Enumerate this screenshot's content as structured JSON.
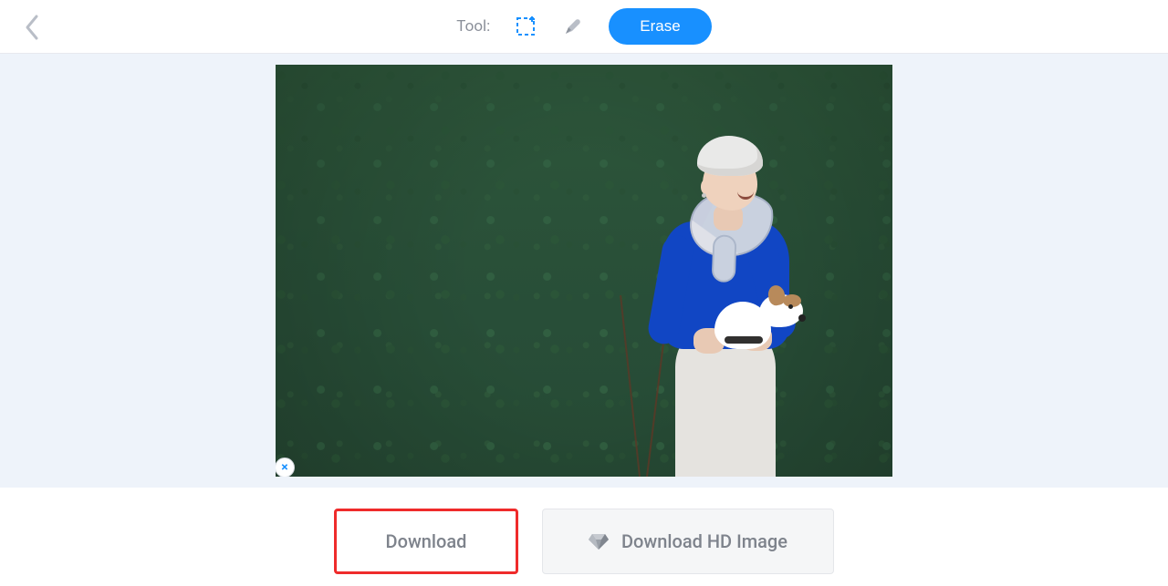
{
  "toolbar": {
    "tool_label": "Tool:",
    "erase_label": "Erase"
  },
  "image": {
    "close_label": "×"
  },
  "downloads": {
    "download_label": "Download",
    "download_hd_label": "Download HD Image"
  }
}
